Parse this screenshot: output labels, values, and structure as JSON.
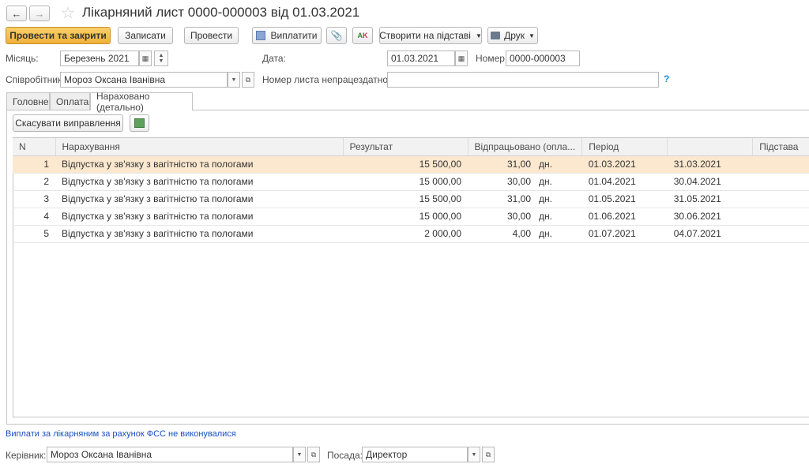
{
  "window": {
    "title": "Лікарняний лист 0000-000003 від 01.03.2021"
  },
  "toolbar": {
    "post_close": "Провести та закрити",
    "save": "Записати",
    "post": "Провести",
    "pay": "Виплатити",
    "create_based": "Створити на підставі",
    "print": "Друк"
  },
  "header": {
    "month_label": "Місяць:",
    "month_value": "Березень 2021",
    "date_label": "Дата:",
    "date_value": "01.03.2021",
    "number_label": "Номер:",
    "number_value": "0000-000003",
    "employee_label": "Співробітник:",
    "employee_value": "Мороз Оксана Іванівна",
    "sick_number_label": "Номер листа непрацездатності:",
    "sick_number_value": "",
    "help": "?"
  },
  "tabs": [
    "Головне",
    "Оплата",
    "Нараховано (детально)"
  ],
  "detail": {
    "cancel_fix": "Скасувати виправлення"
  },
  "table": {
    "columns": [
      "N",
      "Нарахування",
      "Результат",
      "Відпрацьовано (опла...",
      "Період",
      "",
      "Підстава"
    ],
    "rows": [
      {
        "n": "1",
        "accrual": "Відпустка у зв'язку з вагітністю та пологами",
        "result": "15 500,00",
        "worked": "31,00",
        "unit": "дн.",
        "from": "01.03.2021",
        "to": "31.03.2021",
        "basis": ""
      },
      {
        "n": "2",
        "accrual": "Відпустка у зв'язку з вагітністю та пологами",
        "result": "15 000,00",
        "worked": "30,00",
        "unit": "дн.",
        "from": "01.04.2021",
        "to": "30.04.2021",
        "basis": ""
      },
      {
        "n": "3",
        "accrual": "Відпустка у зв'язку з вагітністю та пологами",
        "result": "15 500,00",
        "worked": "31,00",
        "unit": "дн.",
        "from": "01.05.2021",
        "to": "31.05.2021",
        "basis": ""
      },
      {
        "n": "4",
        "accrual": "Відпустка у зв'язку з вагітністю та пологами",
        "result": "15 000,00",
        "worked": "30,00",
        "unit": "дн.",
        "from": "01.06.2021",
        "to": "30.06.2021",
        "basis": ""
      },
      {
        "n": "5",
        "accrual": "Відпустка у зв'язку з вагітністю та пологами",
        "result": "2 000,00",
        "worked": "4,00",
        "unit": "дн.",
        "from": "01.07.2021",
        "to": "04.07.2021",
        "basis": ""
      }
    ]
  },
  "footer": {
    "fss_note": "Виплати за лікарняним за рахунок ФСС не виконувалися",
    "manager_label": "Керівник:",
    "manager_value": "Мороз Оксана Іванівна",
    "position_label": "Посада:",
    "position_value": "Директор"
  },
  "colors": {
    "primary_button": "#f0b13b",
    "selected_row": "#fbe8cf",
    "link": "#1a4fc2"
  }
}
